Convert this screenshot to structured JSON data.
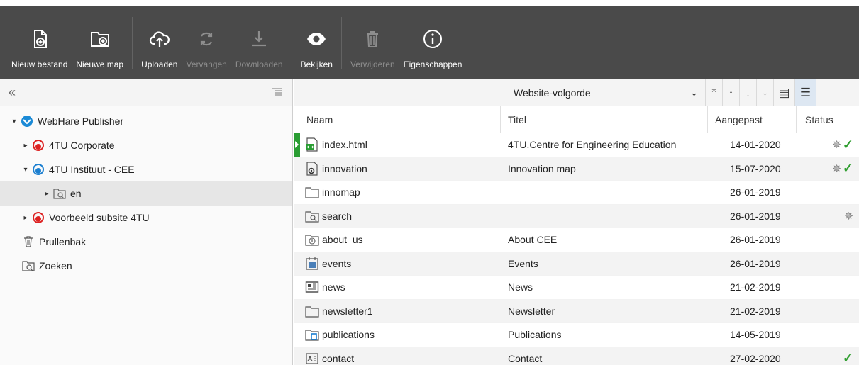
{
  "toolbar": {
    "buttons": [
      {
        "label": "Nieuw bestand",
        "icon": "new-file-icon",
        "enabled": true
      },
      {
        "label": "Nieuwe map",
        "icon": "new-folder-icon",
        "enabled": true
      },
      {
        "label": "Uploaden",
        "icon": "cloud-upload-icon",
        "enabled": true
      },
      {
        "label": "Vervangen",
        "icon": "replace-icon",
        "enabled": false
      },
      {
        "label": "Downloaden",
        "icon": "download-icon",
        "enabled": false
      },
      {
        "label": "Bekijken",
        "icon": "eye-icon",
        "enabled": true
      },
      {
        "label": "Verwijderen",
        "icon": "trash-icon",
        "enabled": false
      },
      {
        "label": "Eigenschappen",
        "icon": "info-icon",
        "enabled": true
      }
    ]
  },
  "tree": {
    "collapse_glyph": "«",
    "items": [
      {
        "label": "WebHare Publisher",
        "icon": "webhare-globe-icon",
        "caret": "▾"
      },
      {
        "label": "4TU Corporate",
        "icon": "site-red-icon",
        "caret": "▸"
      },
      {
        "label": "4TU Instituut - CEE",
        "icon": "site-blue-icon",
        "caret": "▾"
      },
      {
        "label": "en",
        "icon": "search-folder-icon",
        "caret": "▸"
      },
      {
        "label": "Voorbeeld subsite 4TU",
        "icon": "site-red-icon",
        "caret": "▸"
      },
      {
        "label": "Prullenbak",
        "icon": "trash-icon",
        "caret": ""
      },
      {
        "label": "Zoeken",
        "icon": "search-folder-icon",
        "caret": ""
      }
    ]
  },
  "list": {
    "sort_label": "Website-volgorde",
    "columns": {
      "name": "Naam",
      "title": "Titel",
      "modified": "Aangepast",
      "status": "Status"
    },
    "rows": [
      {
        "name": "index.html",
        "title": "4TU.Centre for Engineering Education",
        "date": "14-01-2020",
        "pin": true,
        "check": true,
        "icon": "html-file-icon"
      },
      {
        "name": "innovation",
        "title": "Innovation map",
        "date": "15-07-2020",
        "pin": true,
        "check": true,
        "icon": "dynamic-file-icon"
      },
      {
        "name": "innomap",
        "title": "",
        "date": "26-01-2019",
        "pin": false,
        "check": false,
        "icon": "folder-icon"
      },
      {
        "name": "search",
        "title": "",
        "date": "26-01-2019",
        "pin": true,
        "check": false,
        "icon": "search-folder-icon"
      },
      {
        "name": "about_us",
        "title": "About CEE",
        "date": "26-01-2019",
        "pin": false,
        "check": false,
        "icon": "info-folder-icon"
      },
      {
        "name": "events",
        "title": "Events",
        "date": "26-01-2019",
        "pin": false,
        "check": false,
        "icon": "calendar-folder-icon"
      },
      {
        "name": "news",
        "title": "News",
        "date": "21-02-2019",
        "pin": false,
        "check": false,
        "icon": "news-folder-icon"
      },
      {
        "name": "newsletter1",
        "title": "Newsletter",
        "date": "21-02-2019",
        "pin": false,
        "check": false,
        "icon": "folder-icon"
      },
      {
        "name": "publications",
        "title": "Publications",
        "date": "14-05-2019",
        "pin": false,
        "check": false,
        "icon": "publications-folder-icon"
      },
      {
        "name": "contact",
        "title": "Contact",
        "date": "27-02-2020",
        "pin": false,
        "check": true,
        "icon": "contact-file-icon"
      }
    ]
  }
}
